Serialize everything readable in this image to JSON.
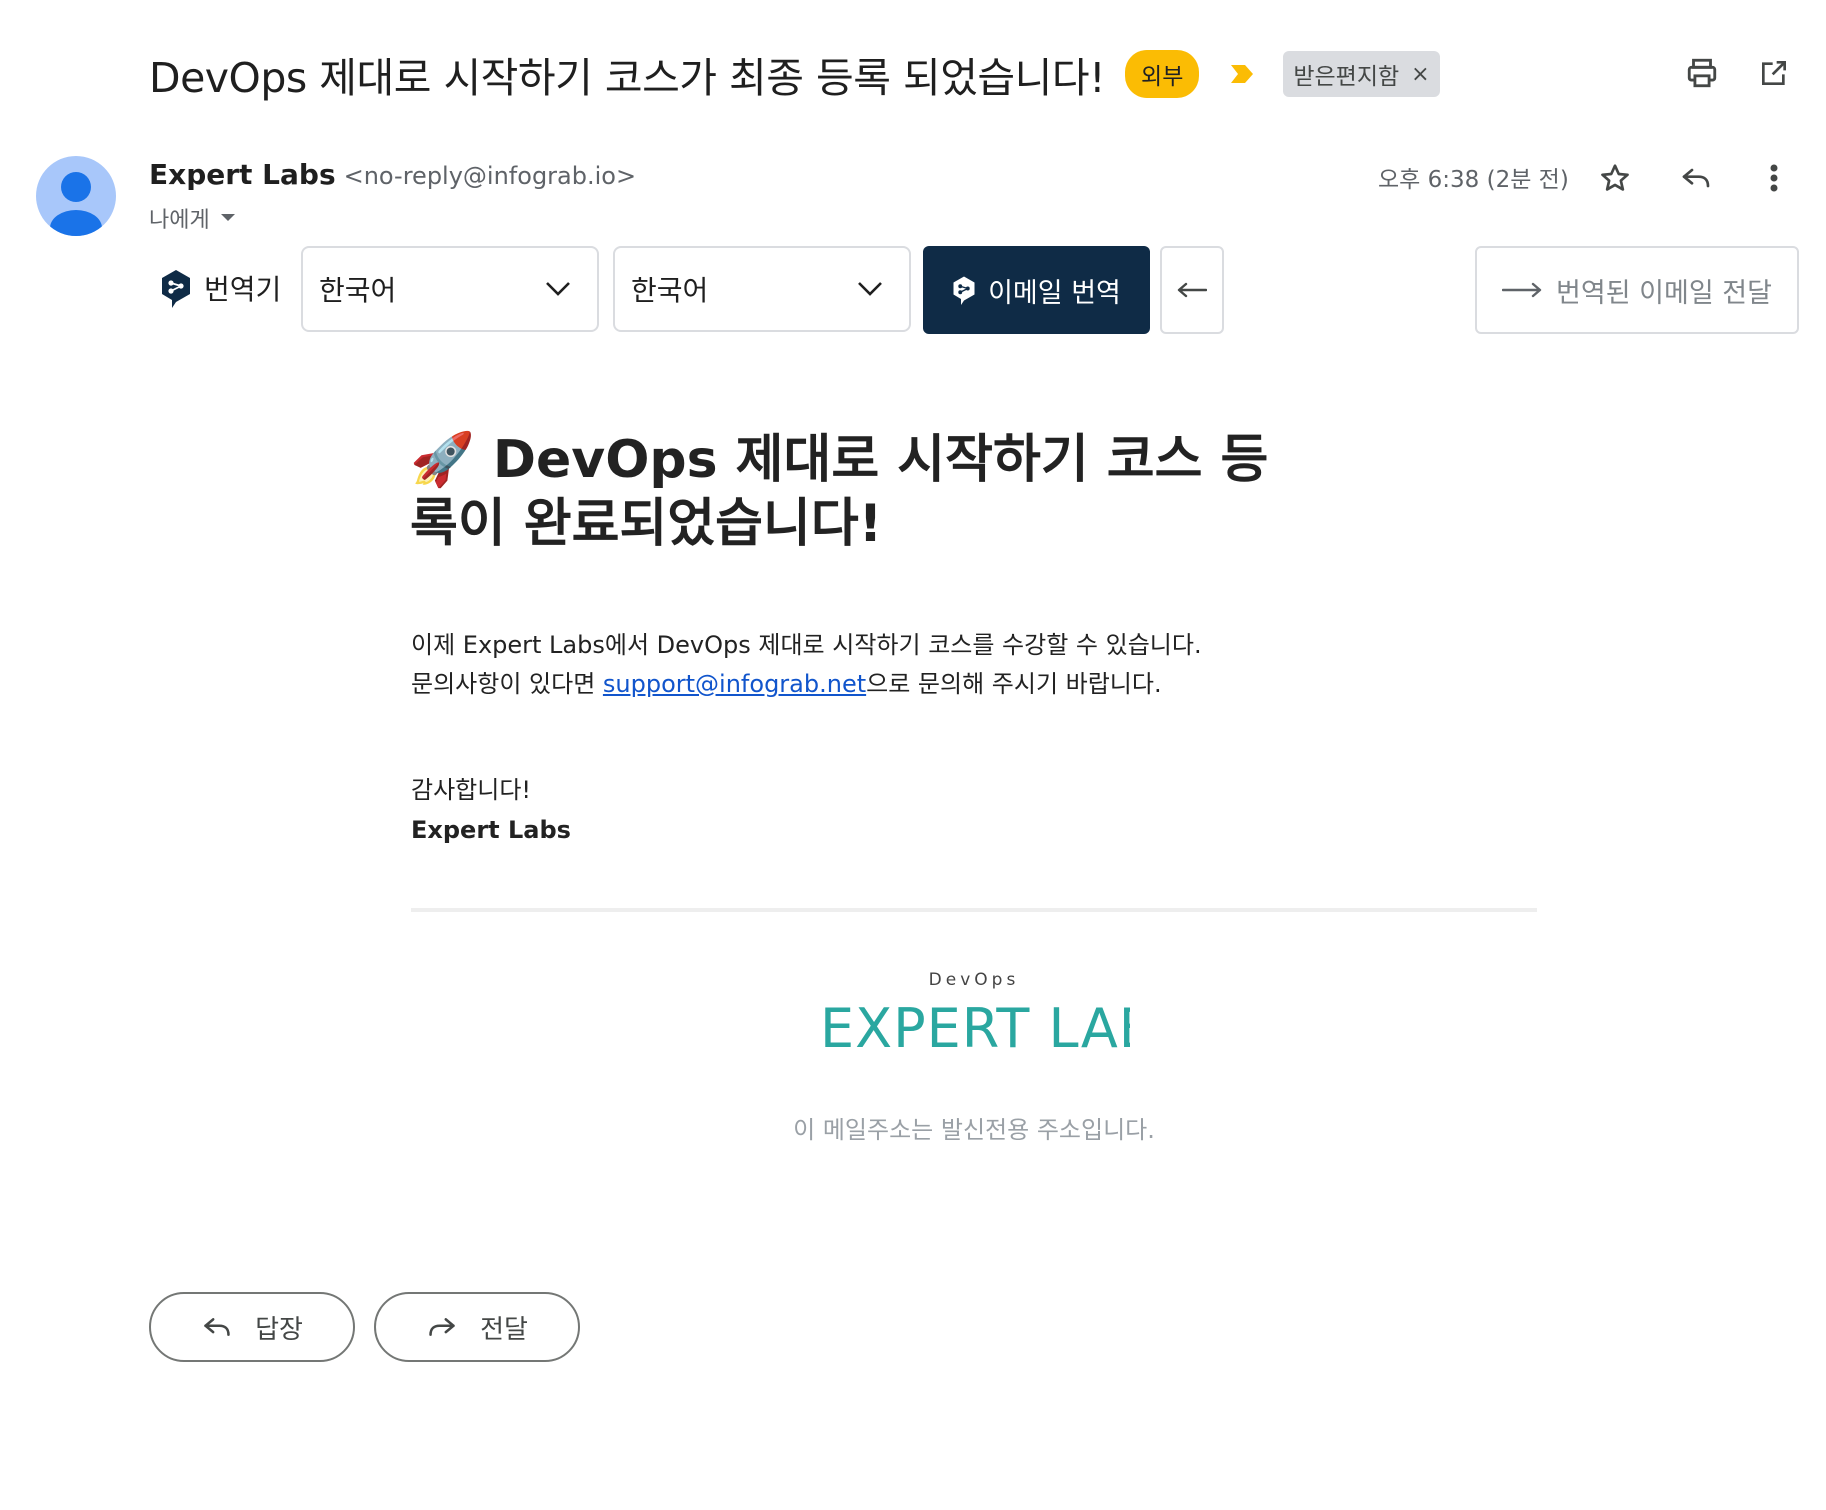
{
  "header": {
    "subject": "DevOps 제대로 시작하기 코스가 최종 등록 되었습니다!",
    "external_badge": "외부",
    "label_chip": "받은편지함",
    "label_chip_close": "×",
    "icons": [
      "print-icon",
      "open-in-new-window-icon"
    ]
  },
  "sender": {
    "name": "Expert Labs",
    "email": "<no-reply@infograb.io>",
    "to": "나에게",
    "time": "오후 6:38 (2분 전)",
    "icons": [
      "star-icon",
      "reply-icon",
      "more-vert-icon"
    ]
  },
  "translator": {
    "label": "번역기",
    "source_lang": "한국어",
    "target_lang": "한국어",
    "translate_button": "이메일 번역",
    "forward_translated": "번역된 이메일 전달"
  },
  "body": {
    "title_emoji": "🚀",
    "title": "DevOps 제대로 시작하기 코스 등록이 완료되었습니다!",
    "line1": "이제 Expert Labs에서 DevOps 제대로 시작하기 코스를 수강할 수 있습니다.",
    "line2_pre": "문의사항이 있다면 ",
    "line2_link": "support@infograb.net",
    "line2_post": "으로 문의해 주시기 바랍니다.",
    "thanks": "감사합니다!",
    "signature": "Expert Labs",
    "logo_small": "DevOps",
    "logo_main": "EXPERT LABS",
    "noreply_notice": "이 메일주소는 발신전용 주소입니다."
  },
  "actions": {
    "reply": "답장",
    "forward": "전달"
  },
  "colors": {
    "external_badge": "#fbbc04",
    "important_marker": "#fbbc04",
    "translate_button_bg": "#0f2b46",
    "logo_teal": "#2aa7a0",
    "link": "#1155cc"
  }
}
